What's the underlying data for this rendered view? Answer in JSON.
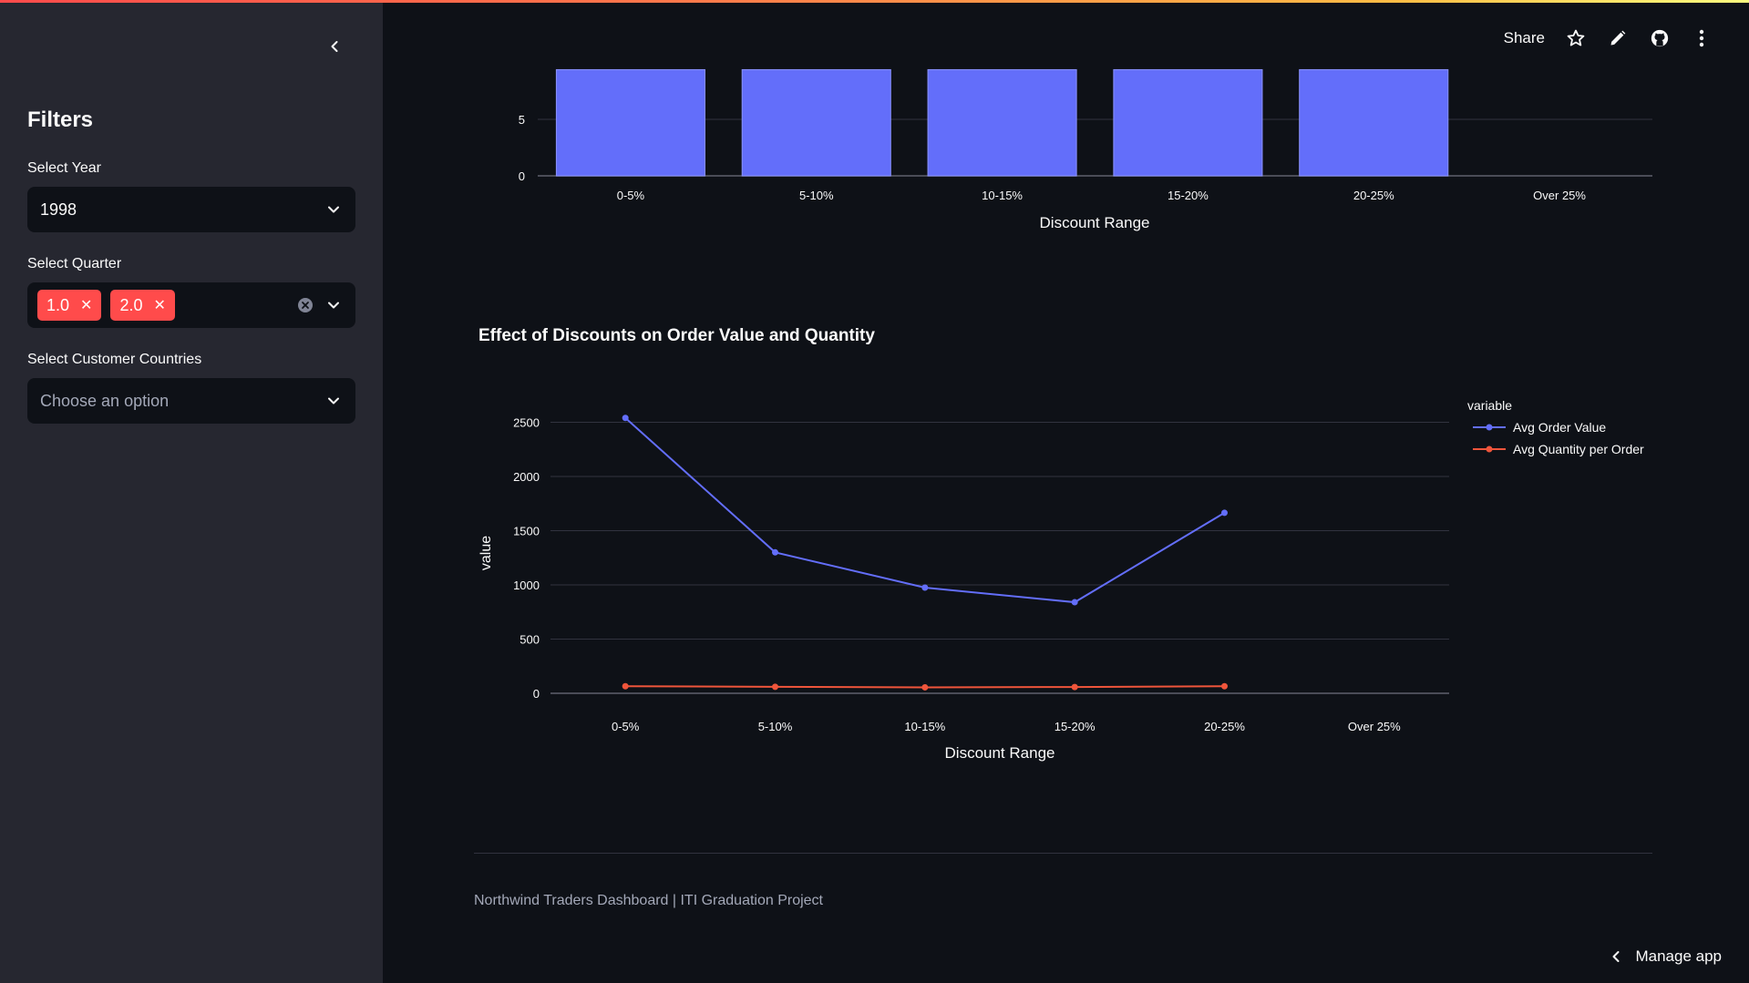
{
  "sidebar": {
    "filters_title": "Filters",
    "year_label": "Select Year",
    "year_value": "1998",
    "quarter_label": "Select Quarter",
    "quarter_tags": [
      "1.0",
      "2.0"
    ],
    "countries_label": "Select Customer Countries",
    "countries_placeholder": "Choose an option"
  },
  "header": {
    "share_label": "Share",
    "icons": [
      "star-icon",
      "pencil-icon",
      "github-icon",
      "more-vertical-icon"
    ]
  },
  "charts": [
    {
      "type": "bar",
      "xlabel": "Discount Range",
      "categories": [
        "0-5%",
        "5-10%",
        "10-15%",
        "15-20%",
        "20-25%",
        "Over 25%"
      ],
      "values": [
        9.4,
        9.4,
        9.4,
        9.4,
        9.4,
        0
      ],
      "yticks": [
        0,
        5
      ],
      "bar_color": "#636efa"
    },
    {
      "type": "line",
      "title": "Effect of Discounts on Order Value and Quantity",
      "xlabel": "Discount Range",
      "ylabel": "value",
      "categories": [
        "0-5%",
        "5-10%",
        "10-15%",
        "15-20%",
        "20-25%",
        "Over 25%"
      ],
      "ylim": [
        0,
        2580
      ],
      "yticks": [
        0,
        500,
        1000,
        1500,
        2000,
        2500
      ],
      "legend_title": "variable",
      "series": [
        {
          "name": "Avg Order Value",
          "color": "#636efa",
          "values": [
            2540,
            1300,
            975,
            840,
            1665
          ]
        },
        {
          "name": "Avg Quantity per Order",
          "color": "#ef553b",
          "values": [
            65,
            60,
            55,
            58,
            65
          ]
        }
      ]
    }
  ],
  "chart_data": [
    {
      "type": "bar",
      "xlabel": "Discount Range",
      "categories": [
        "0-5%",
        "5-10%",
        "10-15%",
        "15-20%",
        "20-25%",
        "Over 25%"
      ],
      "values": [
        9.4,
        9.4,
        9.4,
        9.4,
        9.4,
        0
      ]
    },
    {
      "type": "line",
      "title": "Effect of Discounts on Order Value and Quantity",
      "xlabel": "Discount Range",
      "ylabel": "value",
      "categories": [
        "0-5%",
        "5-10%",
        "10-15%",
        "15-20%",
        "20-25%",
        "Over 25%"
      ],
      "series": [
        {
          "name": "Avg Order Value",
          "values": [
            2540,
            1300,
            975,
            840,
            1665
          ]
        },
        {
          "name": "Avg Quantity per Order",
          "values": [
            65,
            60,
            55,
            58,
            65
          ]
        }
      ]
    }
  ],
  "footer": {
    "text": "Northwind Traders Dashboard | ITI Graduation Project",
    "manage_app_label": "Manage app"
  }
}
